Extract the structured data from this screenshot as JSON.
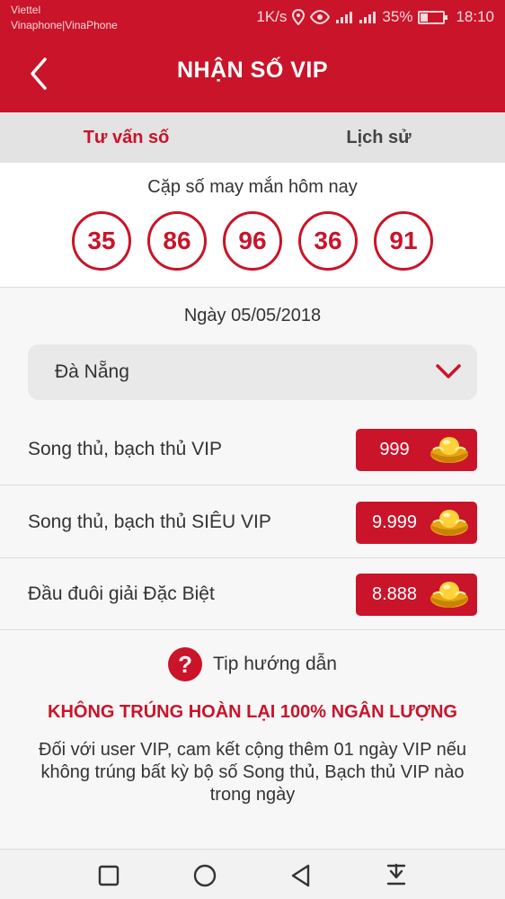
{
  "status_bar": {
    "carrier_1": "Viettel",
    "carrier_2": "Vinaphone|VinaPhone",
    "speed": "1K/s",
    "battery": "35%",
    "battery_level": 0.35,
    "time": "18:10"
  },
  "header": {
    "title": "NHẬN SỐ VIP",
    "back_icon": "back-arrow-icon"
  },
  "tabs": [
    {
      "label": "Tư vấn số",
      "active": true
    },
    {
      "label": "Lịch sử",
      "active": false
    }
  ],
  "lucky": {
    "title": "Cặp số may mắn hôm nay",
    "numbers": [
      "35",
      "86",
      "96",
      "36",
      "91"
    ]
  },
  "date": "Ngày 05/05/2018",
  "region_select": {
    "value": "Đà Nẵng",
    "icon": "chevron-down-icon"
  },
  "packages": [
    {
      "label": "Song thủ, bạch thủ VIP",
      "price": "999",
      "icon": "gold-ingot-icon"
    },
    {
      "label": "Song thủ, bạch thủ SIÊU VIP",
      "price": "9.999",
      "icon": "gold-ingot-icon"
    },
    {
      "label": "Đầu đuôi giải Đặc Biệt",
      "price": "8.888",
      "icon": "gold-ingot-icon"
    }
  ],
  "help": {
    "icon_glyph": "?",
    "label": "Tip hướng dẫn"
  },
  "guarantee": "KHÔNG TRÚNG HOÀN LẠI 100% NGÂN LƯỢNG",
  "description": "Đối với user VIP, cam kết cộng thêm 01 ngày VIP nếu không trúng bất kỳ bộ số Song thủ, Bạch thủ VIP nào trong ngày",
  "colors": {
    "primary": "#c9142a",
    "tab_bg": "#e3e3e3",
    "select_bg": "#e9e9e9"
  }
}
